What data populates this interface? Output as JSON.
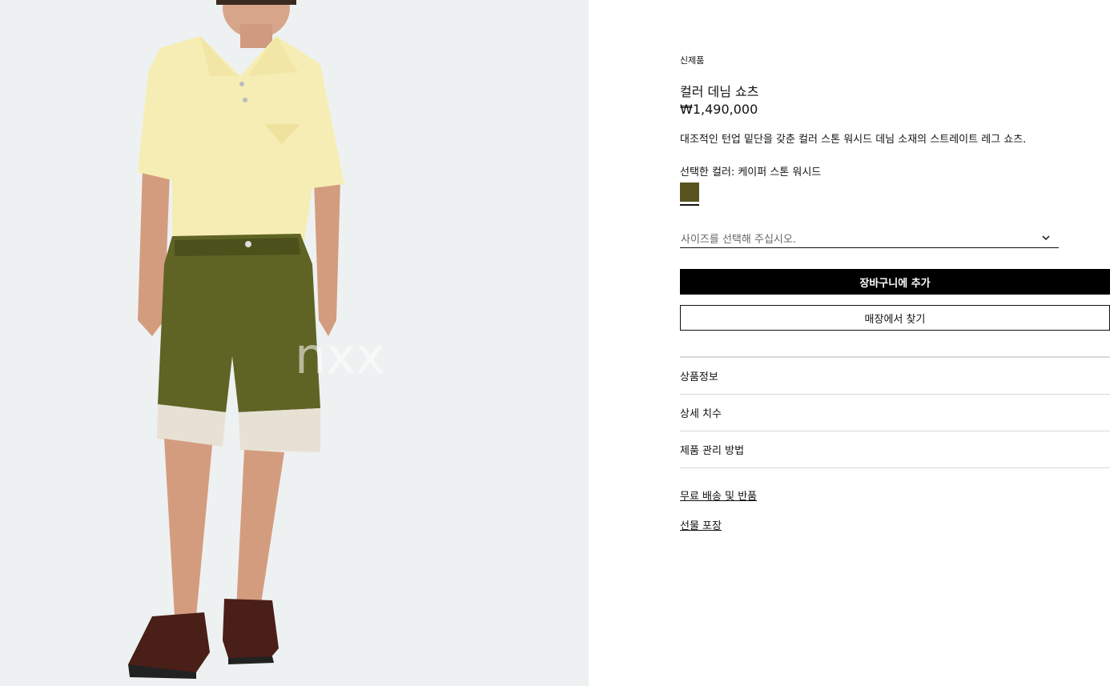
{
  "product": {
    "badge": "신제품",
    "title": "컬러 데님 쇼츠",
    "price": "₩1,490,000",
    "description": "대조적인 턴업 밑단을 갖춘 컬러 스톤 워시드 데님 소재의 스트레이트 레그 쇼츠.",
    "image_watermark": "nxx"
  },
  "color": {
    "label": "선택한 컬러:",
    "value": "케이퍼 스톤 워시드",
    "swatch_hex": "#58521f"
  },
  "size_select": {
    "placeholder": "사이즈를 선택해 주십시오."
  },
  "buttons": {
    "add_to_cart": "장바구니에 추가",
    "find_in_store": "매장에서 찾기"
  },
  "accordion": [
    {
      "label": "상품정보"
    },
    {
      "label": "상세 치수"
    },
    {
      "label": "제품 관리 방법"
    }
  ],
  "links": [
    {
      "label": "무료 배송 및 반품"
    },
    {
      "label": "선물 포장"
    }
  ],
  "colors": {
    "image_bg": "#eef1f1",
    "primary_button": "#000000"
  }
}
